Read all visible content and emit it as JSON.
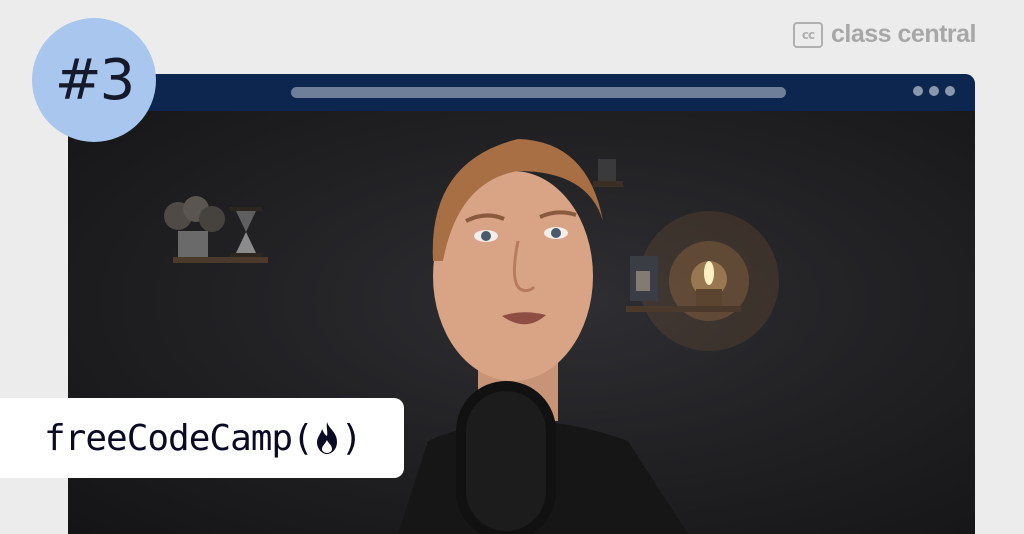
{
  "brand": {
    "logo_mark": "cc",
    "logo_text": "class central"
  },
  "badge": {
    "label": "#3"
  },
  "window": {
    "controls_icon": "more-dots-icon"
  },
  "footer_brand": {
    "name": "freeCodeCamp",
    "open_paren": "(",
    "close_paren": ")",
    "icon": "flame-icon"
  },
  "colors": {
    "background": "#ececec",
    "titlebar": "#0d2650",
    "badge": "#a9c6ef",
    "logo_gray": "#a7a7a7",
    "fcc_text": "#0a0a23"
  }
}
